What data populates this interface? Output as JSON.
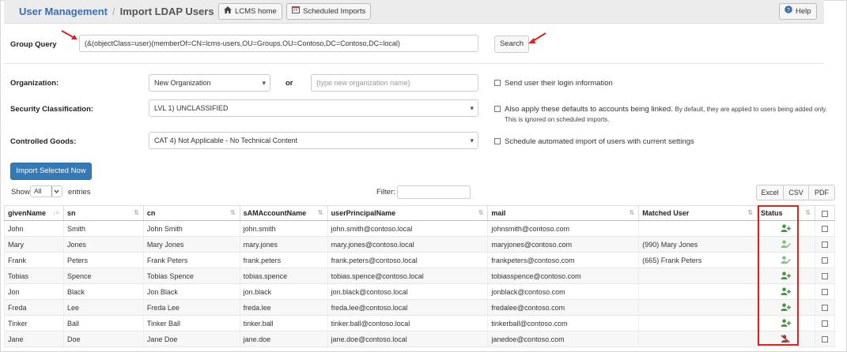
{
  "header": {
    "breadcrumb_root": "User Management",
    "separator": "/",
    "breadcrumb_current": "Import LDAP Users",
    "home_button": "LCMS home",
    "scheduled_button": "Scheduled Imports",
    "help_button": "Help"
  },
  "query": {
    "label": "Group Query",
    "value": "(&(objectClass=user)(memberOf=CN=lcms-users,OU=Groups,OU=Contoso,DC=Contoso,DC=local)",
    "search_button": "Search"
  },
  "form": {
    "org_label": "Organization:",
    "org_select": "New Organization",
    "or_text": "or",
    "org_placeholder": "{type new organization name}",
    "security_label": "Security Classification:",
    "security_select": "LVL 1) UNCLASSIFIED",
    "controlled_label": "Controlled Goods:",
    "controlled_select": "CAT 4) Not Applicable - No Technical Content",
    "send_login": "Send user their login information",
    "apply_defaults": "Also apply these defaults to accounts being linked.",
    "apply_note1": "By default, they are applied to users being added only.",
    "apply_note2": "This is ignored on scheduled imports.",
    "schedule_import": "Schedule automated import of users with current settings"
  },
  "actions": {
    "import_button": "Import Selected Now",
    "show_label": "Show",
    "show_value": "All",
    "entries_label": "entries",
    "filter_label": "Filter:",
    "export": [
      "Excel",
      "CSV",
      "PDF"
    ]
  },
  "table": {
    "columns": [
      "givenName",
      "sn",
      "cn",
      "sAMAccountName",
      "userPrincipalName",
      "mail",
      "Matched User",
      "Status"
    ],
    "rows": [
      {
        "givenName": "John",
        "sn": "Smith",
        "cn": "John Smith",
        "sam": "john.smith",
        "upn": "john.smith@contoso.local",
        "mail": "johnsmith@contoso.com",
        "matched": "",
        "status": "add"
      },
      {
        "givenName": "Mary",
        "sn": "Jones",
        "cn": "Mary Jones",
        "sam": "mary.jones",
        "upn": "mary.jones@contoso.local",
        "mail": "maryjones@contoso.com",
        "matched": "(990) Mary Jones",
        "status": "link"
      },
      {
        "givenName": "Frank",
        "sn": "Peters",
        "cn": "Frank Peters",
        "sam": "frank.peters",
        "upn": "frank.peters@contoso.local",
        "mail": "frankpeters@contoso.com",
        "matched": "(665) Frank Peters",
        "status": "link"
      },
      {
        "givenName": "Tobias",
        "sn": "Spence",
        "cn": "Tobias Spence",
        "sam": "tobias.spence",
        "upn": "tobias.spence@contoso.local",
        "mail": "tobiasspence@contoso.com",
        "matched": "",
        "status": "add"
      },
      {
        "givenName": "Jon",
        "sn": "Black",
        "cn": "Jon Black",
        "sam": "jon.black",
        "upn": "jon.black@contoso.local",
        "mail": "jonblack@contoso.com",
        "matched": "",
        "status": "add"
      },
      {
        "givenName": "Freda",
        "sn": "Lee",
        "cn": "Freda Lee",
        "sam": "freda.lee",
        "upn": "freda.lee@contoso.local",
        "mail": "fredalee@contoso.com",
        "matched": "",
        "status": "add"
      },
      {
        "givenName": "Tinker",
        "sn": "Ball",
        "cn": "Tinker Ball",
        "sam": "tinker.ball",
        "upn": "tinker.ball@contoso.local",
        "mail": "tinkerball@contoso.com",
        "matched": "",
        "status": "add"
      },
      {
        "givenName": "Jane",
        "sn": "Doe",
        "cn": "Jane Doe",
        "sam": "jane.doe",
        "upn": "jane.doe@contoso.local",
        "mail": "janedoe@contoso.com",
        "matched": "",
        "status": "blocked"
      }
    ]
  },
  "colors": {
    "brand": "#3a6fb5",
    "primary_button": "#337ab7",
    "status_green": "#3a9a3a",
    "status_light_green": "#7cc47c",
    "highlight_red": "#e02020"
  }
}
